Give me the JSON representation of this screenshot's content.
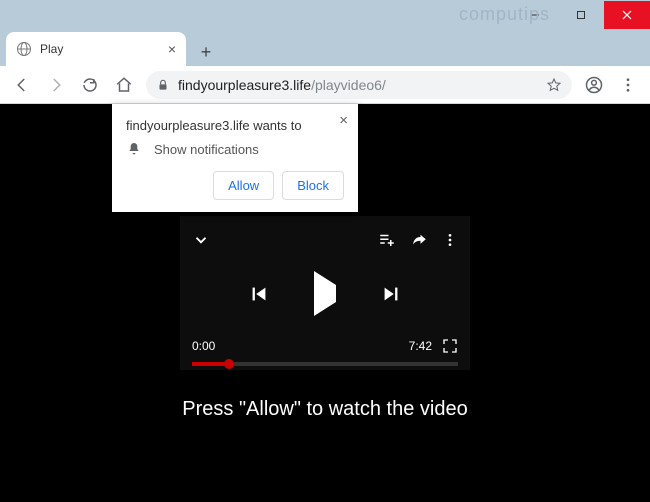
{
  "watermark": "computips",
  "tab": {
    "title": "Play"
  },
  "address": {
    "host": "findyourpleasure3.life",
    "path": "/playvideo6/"
  },
  "popup": {
    "origin": "findyourpleasure3.life wants to",
    "permission": "Show notifications",
    "allow": "Allow",
    "block": "Block"
  },
  "player": {
    "elapsed": "0:00",
    "duration": "7:42",
    "progress_pct": 14
  },
  "page": {
    "instruction": "Press \"Allow\" to watch the video"
  }
}
